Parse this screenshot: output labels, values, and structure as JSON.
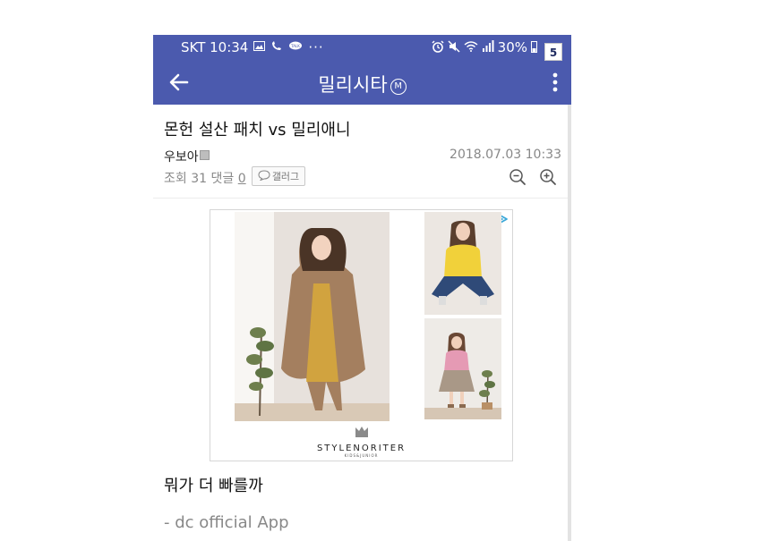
{
  "colors": {
    "brand": "#4b5aae"
  },
  "status_bar": {
    "carrier_time": "SKT 10:34",
    "battery": "30%",
    "badge": "5",
    "icons": [
      "gallery-icon",
      "call-icon",
      "talk-icon",
      "more-dots-icon",
      "alarm-icon",
      "mute-icon",
      "wifi-icon",
      "signal-icon",
      "battery-icon"
    ]
  },
  "appbar": {
    "title": "밀리시타",
    "mark": "M",
    "icons": [
      "back-arrow-icon",
      "overflow-menu-icon"
    ]
  },
  "post": {
    "title": "몬헌 설산 패치 vs 밀리애니",
    "author": "우보아",
    "date": "2018.07.03 10:33",
    "views_label": "조회",
    "views": "31",
    "comments_label": "댓글",
    "comments": "0",
    "gallery_button": "갤러그",
    "body": "뭐가 더 빠를까",
    "signature": "- dc official App"
  },
  "ad": {
    "brand": "STYLENORITER",
    "sub": "KIDS&JUNIOR",
    "icons": [
      "ad-choices-icon"
    ]
  }
}
